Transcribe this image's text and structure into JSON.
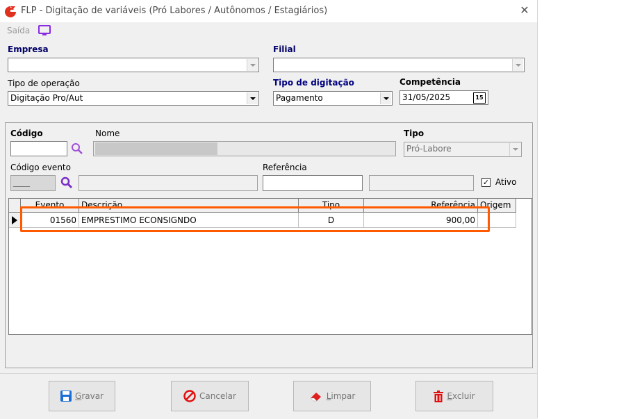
{
  "window": {
    "title": "FLP - Digitação de variáveis (Pró Labores / Autônomos / Estagiários)",
    "close_glyph": "✕"
  },
  "menu": {
    "saida_label": "Saída",
    "monitor_icon": "monitor-icon"
  },
  "header": {
    "empresa_label": "Empresa",
    "empresa_value": "",
    "filial_label": "Filial",
    "filial_value": "",
    "tipo_operacao_label": "Tipo de operação",
    "tipo_operacao_value": "Digitação Pro/Aut",
    "tipo_digitacao_label": "Tipo de digitação",
    "tipo_digitacao_value": "Pagamento",
    "competencia_label": "Competência",
    "competencia_value": "31/05/2025",
    "calendar_glyph": "15"
  },
  "form": {
    "codigo_label": "Código",
    "codigo_value": "",
    "nome_label": "Nome",
    "tipo_label": "Tipo",
    "tipo_value": "Pró-Labore",
    "codigo_evento_label": "Código evento",
    "codigo_evento_value": "____",
    "referencia_label": "Referência",
    "referencia_value": "",
    "ativo_label": "Ativo",
    "ativo_checked": true
  },
  "grid": {
    "columns": [
      "Evento",
      "Descrição",
      "Tipo",
      "Referência",
      "Origem"
    ],
    "rows": [
      {
        "evento": "01560",
        "descricao": "EMPRESTIMO ECONSIGNDO",
        "tipo": "D",
        "referencia": "900,00",
        "origem": ""
      }
    ]
  },
  "buttons": {
    "gravar": {
      "underline": "G",
      "rest": "ravar"
    },
    "cancelar": {
      "label": "Cancelar"
    },
    "limpar": {
      "underline": "L",
      "rest": "impar"
    },
    "excluir": {
      "underline": "E",
      "rest": "xcluir"
    }
  },
  "colors": {
    "highlight": "#ff5a00",
    "accent": "#8a2be2",
    "logo": "#e0301e"
  }
}
